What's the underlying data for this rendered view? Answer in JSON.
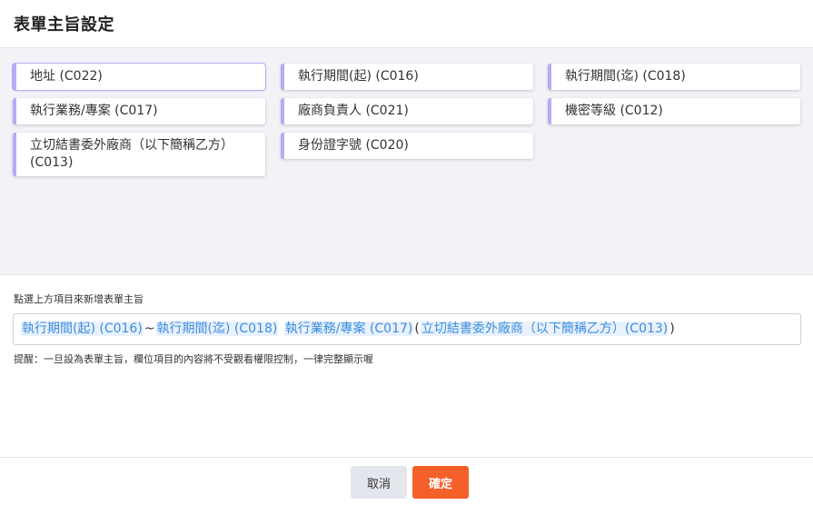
{
  "dialog": {
    "title": "表單主旨設定"
  },
  "fields": [
    {
      "label": "地址 (C022)",
      "selected": true
    },
    {
      "label": "執行期間(起) (C016)",
      "selected": false
    },
    {
      "label": "執行期間(迄) (C018)",
      "selected": false
    },
    {
      "label": "執行業務/專案 (C017)",
      "selected": false
    },
    {
      "label": "廠商負責人 (C021)",
      "selected": false
    },
    {
      "label": "機密等級 (C012)",
      "selected": false
    },
    {
      "label": "立切結書委外廠商（以下簡稱乙方）(C013)",
      "selected": false
    },
    {
      "label": "身份證字號 (C020)",
      "selected": false
    }
  ],
  "subject": {
    "instruction": "點選上方項目來新增表單主旨",
    "tokens": [
      "執行期間(起) (C016)",
      "執行期間(迄) (C018)",
      "執行業務/專案 (C017)",
      "立切結書委外廠商（以下簡稱乙方）(C013)"
    ],
    "separators": [
      "~",
      " ",
      "(",
      ")"
    ],
    "notice": "提醒：一旦設為表單主旨，欄位項目的內容將不受觀看權限控制，一律完整顯示喔"
  },
  "buttons": {
    "cancel": "取消",
    "confirm": "確定"
  },
  "colors": {
    "accent": "#b3adf5",
    "token_text": "#3a8de0",
    "confirm_bg": "#f5602a",
    "panel_bg": "#f2f2f7"
  }
}
